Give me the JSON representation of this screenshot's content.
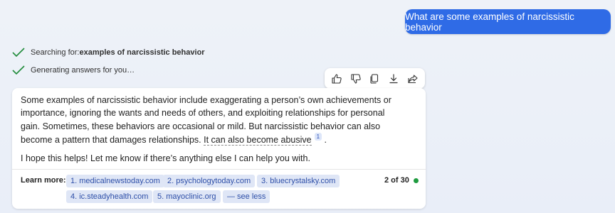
{
  "user_message": "What are some examples of narcissistic behavior",
  "status": {
    "search_prefix": "Searching for: ",
    "search_query": "examples of narcissistic behavior",
    "generating": "Generating answers for you…",
    "check_color": "#1f8b3a"
  },
  "toolbar": {
    "icons": [
      "thumbs-up-icon",
      "thumbs-down-icon",
      "copy-icon",
      "download-icon",
      "share-icon"
    ]
  },
  "answer": {
    "paragraph1_text": "Some examples of narcissistic behavior include exaggerating a person’s own achievements or importance, ignoring the wants and needs of others, and exploiting relationships for personal gain. Sometimes, these behaviors are occasional or mild. But narcissistic behavior can also become a pattern that damages relationships. ",
    "cited_sentence": "It can also become abusive",
    "citation_number": "1",
    "paragraph1_end": " .",
    "paragraph2": "I hope this helps! Let me know if there’s anything else I can help you with."
  },
  "learn_more": {
    "label": "Learn more:",
    "links": [
      "1. medicalnewstoday.com",
      "2. psychologytoday.com",
      "3. bluecrystalsky.com",
      "4. ic.steadyhealth.com",
      "5. mayoclinic.org",
      "— see less"
    ],
    "turn_count": "2 of 30",
    "status_color": "#1f9b3f"
  },
  "colors": {
    "accent": "#2f6be6",
    "chip_bg": "#dfe6f6",
    "chip_text": "#2e4fa8"
  }
}
